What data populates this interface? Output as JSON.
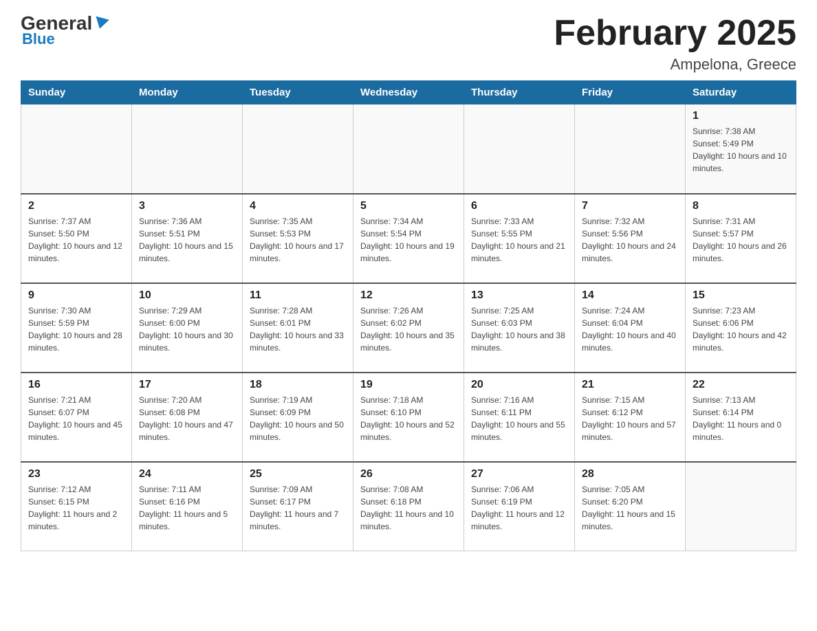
{
  "header": {
    "logo": {
      "general": "General",
      "blue": "Blue",
      "triangle_alt": "logo triangle"
    },
    "month_title": "February 2025",
    "location": "Ampelona, Greece"
  },
  "calendar": {
    "days_of_week": [
      "Sunday",
      "Monday",
      "Tuesday",
      "Wednesday",
      "Thursday",
      "Friday",
      "Saturday"
    ],
    "weeks": [
      {
        "days": [
          {
            "number": "",
            "info": ""
          },
          {
            "number": "",
            "info": ""
          },
          {
            "number": "",
            "info": ""
          },
          {
            "number": "",
            "info": ""
          },
          {
            "number": "",
            "info": ""
          },
          {
            "number": "",
            "info": ""
          },
          {
            "number": "1",
            "info": "Sunrise: 7:38 AM\nSunset: 5:49 PM\nDaylight: 10 hours and 10 minutes."
          }
        ]
      },
      {
        "days": [
          {
            "number": "2",
            "info": "Sunrise: 7:37 AM\nSunset: 5:50 PM\nDaylight: 10 hours and 12 minutes."
          },
          {
            "number": "3",
            "info": "Sunrise: 7:36 AM\nSunset: 5:51 PM\nDaylight: 10 hours and 15 minutes."
          },
          {
            "number": "4",
            "info": "Sunrise: 7:35 AM\nSunset: 5:53 PM\nDaylight: 10 hours and 17 minutes."
          },
          {
            "number": "5",
            "info": "Sunrise: 7:34 AM\nSunset: 5:54 PM\nDaylight: 10 hours and 19 minutes."
          },
          {
            "number": "6",
            "info": "Sunrise: 7:33 AM\nSunset: 5:55 PM\nDaylight: 10 hours and 21 minutes."
          },
          {
            "number": "7",
            "info": "Sunrise: 7:32 AM\nSunset: 5:56 PM\nDaylight: 10 hours and 24 minutes."
          },
          {
            "number": "8",
            "info": "Sunrise: 7:31 AM\nSunset: 5:57 PM\nDaylight: 10 hours and 26 minutes."
          }
        ]
      },
      {
        "days": [
          {
            "number": "9",
            "info": "Sunrise: 7:30 AM\nSunset: 5:59 PM\nDaylight: 10 hours and 28 minutes."
          },
          {
            "number": "10",
            "info": "Sunrise: 7:29 AM\nSunset: 6:00 PM\nDaylight: 10 hours and 30 minutes."
          },
          {
            "number": "11",
            "info": "Sunrise: 7:28 AM\nSunset: 6:01 PM\nDaylight: 10 hours and 33 minutes."
          },
          {
            "number": "12",
            "info": "Sunrise: 7:26 AM\nSunset: 6:02 PM\nDaylight: 10 hours and 35 minutes."
          },
          {
            "number": "13",
            "info": "Sunrise: 7:25 AM\nSunset: 6:03 PM\nDaylight: 10 hours and 38 minutes."
          },
          {
            "number": "14",
            "info": "Sunrise: 7:24 AM\nSunset: 6:04 PM\nDaylight: 10 hours and 40 minutes."
          },
          {
            "number": "15",
            "info": "Sunrise: 7:23 AM\nSunset: 6:06 PM\nDaylight: 10 hours and 42 minutes."
          }
        ]
      },
      {
        "days": [
          {
            "number": "16",
            "info": "Sunrise: 7:21 AM\nSunset: 6:07 PM\nDaylight: 10 hours and 45 minutes."
          },
          {
            "number": "17",
            "info": "Sunrise: 7:20 AM\nSunset: 6:08 PM\nDaylight: 10 hours and 47 minutes."
          },
          {
            "number": "18",
            "info": "Sunrise: 7:19 AM\nSunset: 6:09 PM\nDaylight: 10 hours and 50 minutes."
          },
          {
            "number": "19",
            "info": "Sunrise: 7:18 AM\nSunset: 6:10 PM\nDaylight: 10 hours and 52 minutes."
          },
          {
            "number": "20",
            "info": "Sunrise: 7:16 AM\nSunset: 6:11 PM\nDaylight: 10 hours and 55 minutes."
          },
          {
            "number": "21",
            "info": "Sunrise: 7:15 AM\nSunset: 6:12 PM\nDaylight: 10 hours and 57 minutes."
          },
          {
            "number": "22",
            "info": "Sunrise: 7:13 AM\nSunset: 6:14 PM\nDaylight: 11 hours and 0 minutes."
          }
        ]
      },
      {
        "days": [
          {
            "number": "23",
            "info": "Sunrise: 7:12 AM\nSunset: 6:15 PM\nDaylight: 11 hours and 2 minutes."
          },
          {
            "number": "24",
            "info": "Sunrise: 7:11 AM\nSunset: 6:16 PM\nDaylight: 11 hours and 5 minutes."
          },
          {
            "number": "25",
            "info": "Sunrise: 7:09 AM\nSunset: 6:17 PM\nDaylight: 11 hours and 7 minutes."
          },
          {
            "number": "26",
            "info": "Sunrise: 7:08 AM\nSunset: 6:18 PM\nDaylight: 11 hours and 10 minutes."
          },
          {
            "number": "27",
            "info": "Sunrise: 7:06 AM\nSunset: 6:19 PM\nDaylight: 11 hours and 12 minutes."
          },
          {
            "number": "28",
            "info": "Sunrise: 7:05 AM\nSunset: 6:20 PM\nDaylight: 11 hours and 15 minutes."
          },
          {
            "number": "",
            "info": ""
          }
        ]
      }
    ]
  }
}
